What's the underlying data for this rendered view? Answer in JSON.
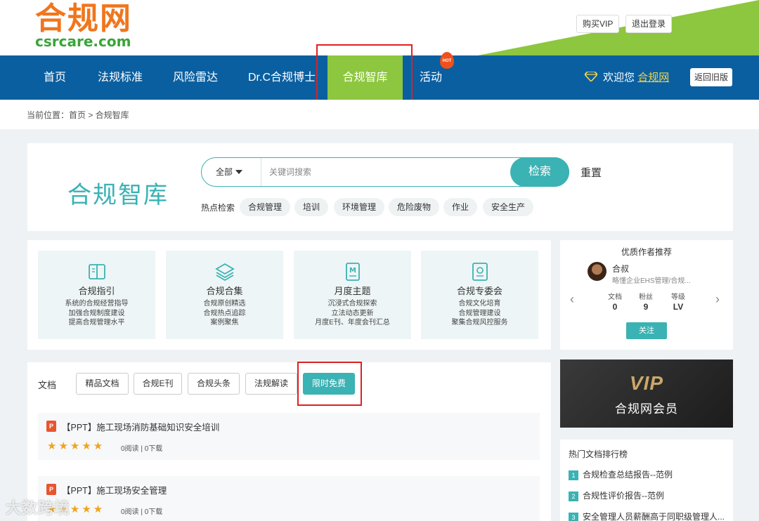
{
  "logo": {
    "cn": "合规网",
    "en": "csrcare.com"
  },
  "header": {
    "buy_vip": "购买VIP",
    "logout": "退出登录"
  },
  "nav": {
    "items": [
      "首页",
      "法规标准",
      "风险雷达",
      "Dr.C合规博士",
      "合规智库",
      "活动"
    ],
    "active_index": 4,
    "hot_badge": "HOT",
    "welcome": "欢迎您",
    "username": "合规网",
    "old_version": "返回旧版"
  },
  "breadcrumb": {
    "text": "当前位置：首页 > 合规智库"
  },
  "search": {
    "title": "合规智库",
    "scope": "全部",
    "placeholder": "关键词搜索",
    "button": "检索",
    "reset": "重置",
    "hot_label": "热点检索",
    "hot_tags": [
      "合规管理",
      "培训",
      "环境管理",
      "危险废物",
      "作业",
      "安全生产"
    ]
  },
  "categories": [
    {
      "icon": "book-icon",
      "title": "合规指引",
      "desc": [
        "系统的合规经营指导",
        "加强合规制度建设",
        "提高合规管理水平"
      ]
    },
    {
      "icon": "layers-icon",
      "title": "合规合集",
      "desc": [
        "合规原创精选",
        "合规热点追踪",
        "案例聚焦"
      ]
    },
    {
      "icon": "document-m-icon",
      "title": "月度主题",
      "desc": [
        "沉浸式合规探索",
        "立法动态更新",
        "月度E刊、年度会刊汇总"
      ]
    },
    {
      "icon": "certificate-icon",
      "title": "合规专委会",
      "desc": [
        "合规文化培育",
        "合规管理建设",
        "聚集合规风控服务"
      ]
    }
  ],
  "author_card": {
    "title": "优质作者推荐",
    "name": "合叔",
    "bio": "略懂企业EHS管理/合规...",
    "stats": [
      {
        "label": "文档",
        "value": "0"
      },
      {
        "label": "粉丝",
        "value": "9"
      },
      {
        "label": "等级",
        "value": "LV"
      }
    ],
    "follow": "关注"
  },
  "docs": {
    "label": "文档",
    "tabs": [
      "精品文档",
      "合规E刊",
      "合规头条",
      "法规解读",
      "限时免费"
    ],
    "active_tab": 4,
    "items": [
      {
        "title": "【PPT】施工现场消防基础知识安全培训",
        "rating": 5,
        "stats": "0阅读 | 0下载"
      },
      {
        "title": "【PPT】施工现场安全管理",
        "rating": 5,
        "stats": "0阅读 | 0下载"
      }
    ]
  },
  "vip": {
    "logo": "VIP",
    "text": "合规网会员"
  },
  "ranking": {
    "title": "热门文档排行榜",
    "items": [
      {
        "num": "1",
        "title": "合规检查总结报告--范例"
      },
      {
        "num": "2",
        "title": "合规性评价报告--范例"
      },
      {
        "num": "3",
        "title": "安全管理人员薪酬高于同职级管理人..."
      }
    ]
  },
  "watermark": "大数跨境",
  "colors": {
    "nav_blue": "#0a5fa0",
    "accent_green": "#8dc63f",
    "teal": "#3bb2b4",
    "logo_orange": "#f0761d",
    "highlight_red": "#e02020"
  }
}
